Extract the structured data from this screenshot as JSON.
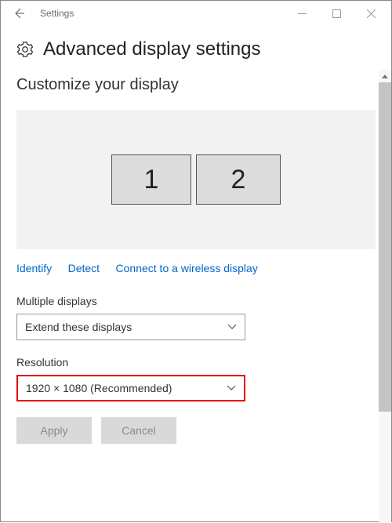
{
  "window": {
    "title": "Settings"
  },
  "header": {
    "page_title": "Advanced display settings"
  },
  "section": {
    "subtitle": "Customize your display"
  },
  "monitors": {
    "primary": "1",
    "secondary": "2"
  },
  "links": {
    "identify": "Identify",
    "detect": "Detect",
    "wireless": "Connect to a wireless display"
  },
  "multiple_displays": {
    "label": "Multiple displays",
    "value": "Extend these displays"
  },
  "resolution": {
    "label": "Resolution",
    "value": "1920 × 1080 (Recommended)"
  },
  "buttons": {
    "apply": "Apply",
    "cancel": "Cancel"
  }
}
